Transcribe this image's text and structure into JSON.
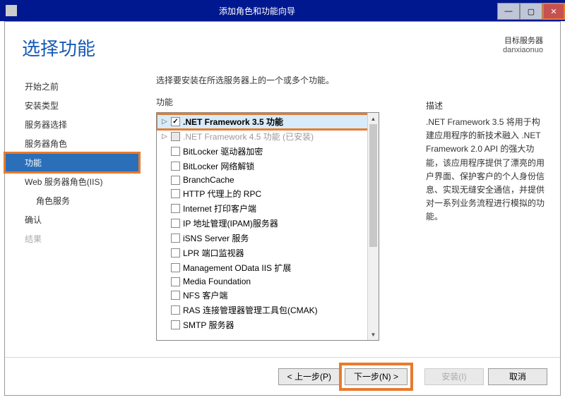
{
  "titlebar": {
    "title": "添加角色和功能向导"
  },
  "header": {
    "title": "选择功能",
    "target_label": "目标服务器",
    "target_name": "danxiaonuo"
  },
  "sidebar": {
    "items": [
      {
        "label": "开始之前",
        "active": false
      },
      {
        "label": "安装类型",
        "active": false
      },
      {
        "label": "服务器选择",
        "active": false
      },
      {
        "label": "服务器角色",
        "active": false
      },
      {
        "label": "功能",
        "active": true
      },
      {
        "label": "Web 服务器角色(IIS)",
        "active": false
      },
      {
        "label": "角色服务",
        "active": false,
        "indent": true
      },
      {
        "label": "确认",
        "active": false
      },
      {
        "label": "结果",
        "active": false,
        "disabled": true
      }
    ]
  },
  "main": {
    "instruction": "选择要安装在所选服务器上的一个或多个功能。",
    "features_label": "功能",
    "features": [
      {
        "label": ".NET Framework 3.5 功能",
        "checked": true,
        "expandable": true,
        "bold": true,
        "highlight": true
      },
      {
        "label": ".NET Framework 4.5 功能 (已安装)",
        "checked": false,
        "expandable": true,
        "disabled": true
      },
      {
        "label": "BitLocker 驱动器加密",
        "checked": false
      },
      {
        "label": "BitLocker 网络解锁",
        "checked": false
      },
      {
        "label": "BranchCache",
        "checked": false
      },
      {
        "label": "HTTP 代理上的 RPC",
        "checked": false
      },
      {
        "label": "Internet 打印客户端",
        "checked": false
      },
      {
        "label": "IP 地址管理(IPAM)服务器",
        "checked": false
      },
      {
        "label": "iSNS Server 服务",
        "checked": false
      },
      {
        "label": "LPR 端口监视器",
        "checked": false
      },
      {
        "label": "Management OData IIS 扩展",
        "checked": false
      },
      {
        "label": "Media Foundation",
        "checked": false
      },
      {
        "label": "NFS 客户端",
        "checked": false
      },
      {
        "label": "RAS 连接管理器管理工具包(CMAK)",
        "checked": false
      },
      {
        "label": "SMTP 服务器",
        "checked": false
      }
    ]
  },
  "desc": {
    "label": "描述",
    "text": ".NET Framework 3.5 将用于构建应用程序的新技术融入 .NET Framework 2.0 API 的强大功能，该应用程序提供了漂亮的用户界面、保护客户的个人身份信息、实现无缝安全通信，并提供对一系列业务流程进行模拟的功能。"
  },
  "footer": {
    "prev": "< 上一步(P)",
    "next": "下一步(N) >",
    "install": "安装(I)",
    "cancel": "取消"
  }
}
